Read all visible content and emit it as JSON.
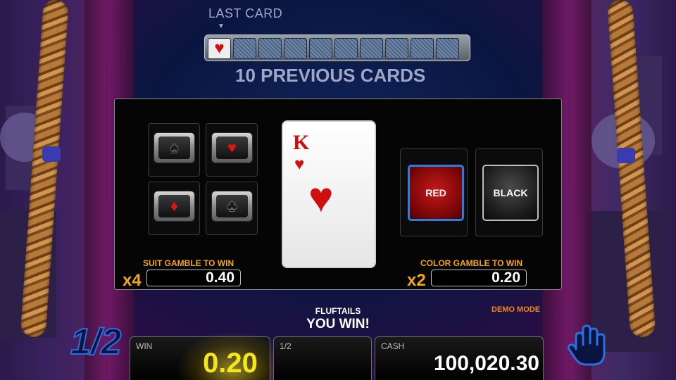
{
  "header": {
    "last_card_label": "LAST CARD",
    "previous_cards_label": "10 PREVIOUS CARDS",
    "pointer_glyph": "▼",
    "history": [
      {
        "type": "face",
        "suit": "heart",
        "glyph": "♥"
      },
      {
        "type": "back"
      },
      {
        "type": "back"
      },
      {
        "type": "back"
      },
      {
        "type": "back"
      },
      {
        "type": "back"
      },
      {
        "type": "back"
      },
      {
        "type": "back"
      },
      {
        "type": "back"
      },
      {
        "type": "back"
      }
    ]
  },
  "suits": {
    "spade": "♠",
    "heart": "♥",
    "diamond": "♦",
    "club": "♣"
  },
  "current_card": {
    "rank": "K",
    "suit": "heart",
    "suit_glyph": "♥"
  },
  "suit_gamble": {
    "label": "SUIT GAMBLE TO WIN",
    "multiplier": "x4",
    "value": "0.40"
  },
  "color_gamble": {
    "label": "COLOR GAMBLE TO WIN",
    "multiplier": "x2",
    "value": "0.20",
    "red_label": "RED",
    "black_label": "BLACK",
    "selected": "RED"
  },
  "status": {
    "player_name": "FLUFTAILS",
    "message": "YOU WIN!",
    "mode": "DEMO MODE"
  },
  "bottom_bar": {
    "half_icon_text": "1/2",
    "win_label": "WIN",
    "win_value": "0.20",
    "half_label": "1/2",
    "cash_label": "CASH",
    "cash_value": "100,020.30"
  },
  "colors": {
    "accent_orange": "#f2a516",
    "win_yellow": "#f5e61c",
    "card_red": "#d10e0e",
    "selection_blue": "#2f7ce0"
  }
}
